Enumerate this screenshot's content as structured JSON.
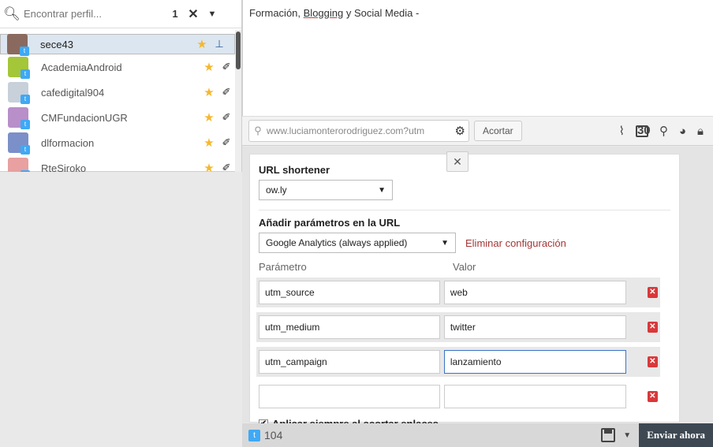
{
  "profiles_panel": {
    "search_placeholder": "Encontrar perfil...",
    "selected_count": "1",
    "clear_icon": "close-icon",
    "dropdown_icon": "caret-down-icon",
    "profiles": [
      {
        "name": "sece43",
        "selected": true,
        "avatar_color": "#8a6a5e"
      },
      {
        "name": "AcademiaAndroid",
        "selected": false,
        "avatar_color": "#a4c639"
      },
      {
        "name": "cafedigital904",
        "selected": false,
        "avatar_color": "#c8d0da"
      },
      {
        "name": "CMFundacionUGR",
        "selected": false,
        "avatar_color": "#b88fc9"
      },
      {
        "name": "dlformacion",
        "selected": false,
        "avatar_color": "#7b8fc9"
      },
      {
        "name": "RteSiroko",
        "selected": false,
        "avatar_color": "#e8a0a0"
      }
    ]
  },
  "compose": {
    "message_before": "Formación, ",
    "message_underlined": "Blogging",
    "message_after": " y Social Media -"
  },
  "link_bar": {
    "url": "www.luciamonterorodriguez.com?utm",
    "shorten_label": "Acortar",
    "icons": [
      "attachment-icon",
      "calendar-icon",
      "location-icon",
      "globe-icon",
      "lock-icon"
    ],
    "calendar_day": "30"
  },
  "shortener": {
    "title": "URL shortener",
    "service": "ow.ly",
    "params_title": "Añadir parámetros en la URL",
    "preset": "Google Analytics (always applied)",
    "remove_label": "Eliminar configuración",
    "col_param": "Parámetro",
    "col_value": "Valor",
    "rows": [
      {
        "key": "utm_source",
        "value": "web"
      },
      {
        "key": "utm_medium",
        "value": "twitter"
      },
      {
        "key": "utm_campaign",
        "value": "lanzamiento"
      }
    ],
    "always_label": "Aplicar siempre al acortar enlaces",
    "always_checked": true
  },
  "footer": {
    "char_count": "104",
    "send_label": "Enviar ahora"
  },
  "colors": {
    "selected_row": "#dce6f0",
    "twitter_blue": "#3fa9f5",
    "star": "#f5b82e",
    "delete_red": "#d9383a",
    "send_button": "#3d4852"
  }
}
